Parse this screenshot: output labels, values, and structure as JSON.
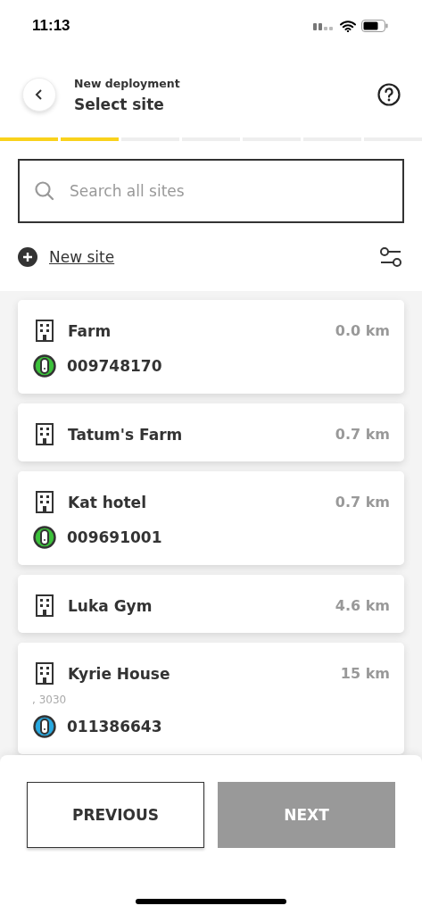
{
  "status_bar": {
    "time": "11:13"
  },
  "header": {
    "subtitle": "New deployment",
    "title": "Select site"
  },
  "progress": [
    {
      "done": true
    },
    {
      "done": true
    },
    {
      "done": false
    },
    {
      "done": false
    },
    {
      "done": false
    },
    {
      "done": false
    },
    {
      "done": false
    }
  ],
  "search": {
    "placeholder": "Search all sites"
  },
  "new_site_link": "New site",
  "sites": [
    {
      "name": "Farm",
      "distance": "0.0 km",
      "devices": [
        {
          "serial": "009748170",
          "color": "#3cc13b"
        }
      ]
    },
    {
      "name": "Tatum's Farm",
      "distance": "0.7 km"
    },
    {
      "name": "Kat hotel",
      "distance": "0.7 km",
      "devices": [
        {
          "serial": "009691001",
          "color": "#3cc13b"
        }
      ]
    },
    {
      "name": "Luka Gym",
      "distance": "4.6 km"
    },
    {
      "name": "Kyrie House",
      "distance": "15 km",
      "address": ", 3030",
      "devices": [
        {
          "serial": "011386643",
          "color": "#29a9e0"
        }
      ]
    }
  ],
  "buttons": [
    {
      "label": "PREVIOUS",
      "disabled": false
    },
    {
      "label": "NEXT",
      "disabled": true
    }
  ]
}
